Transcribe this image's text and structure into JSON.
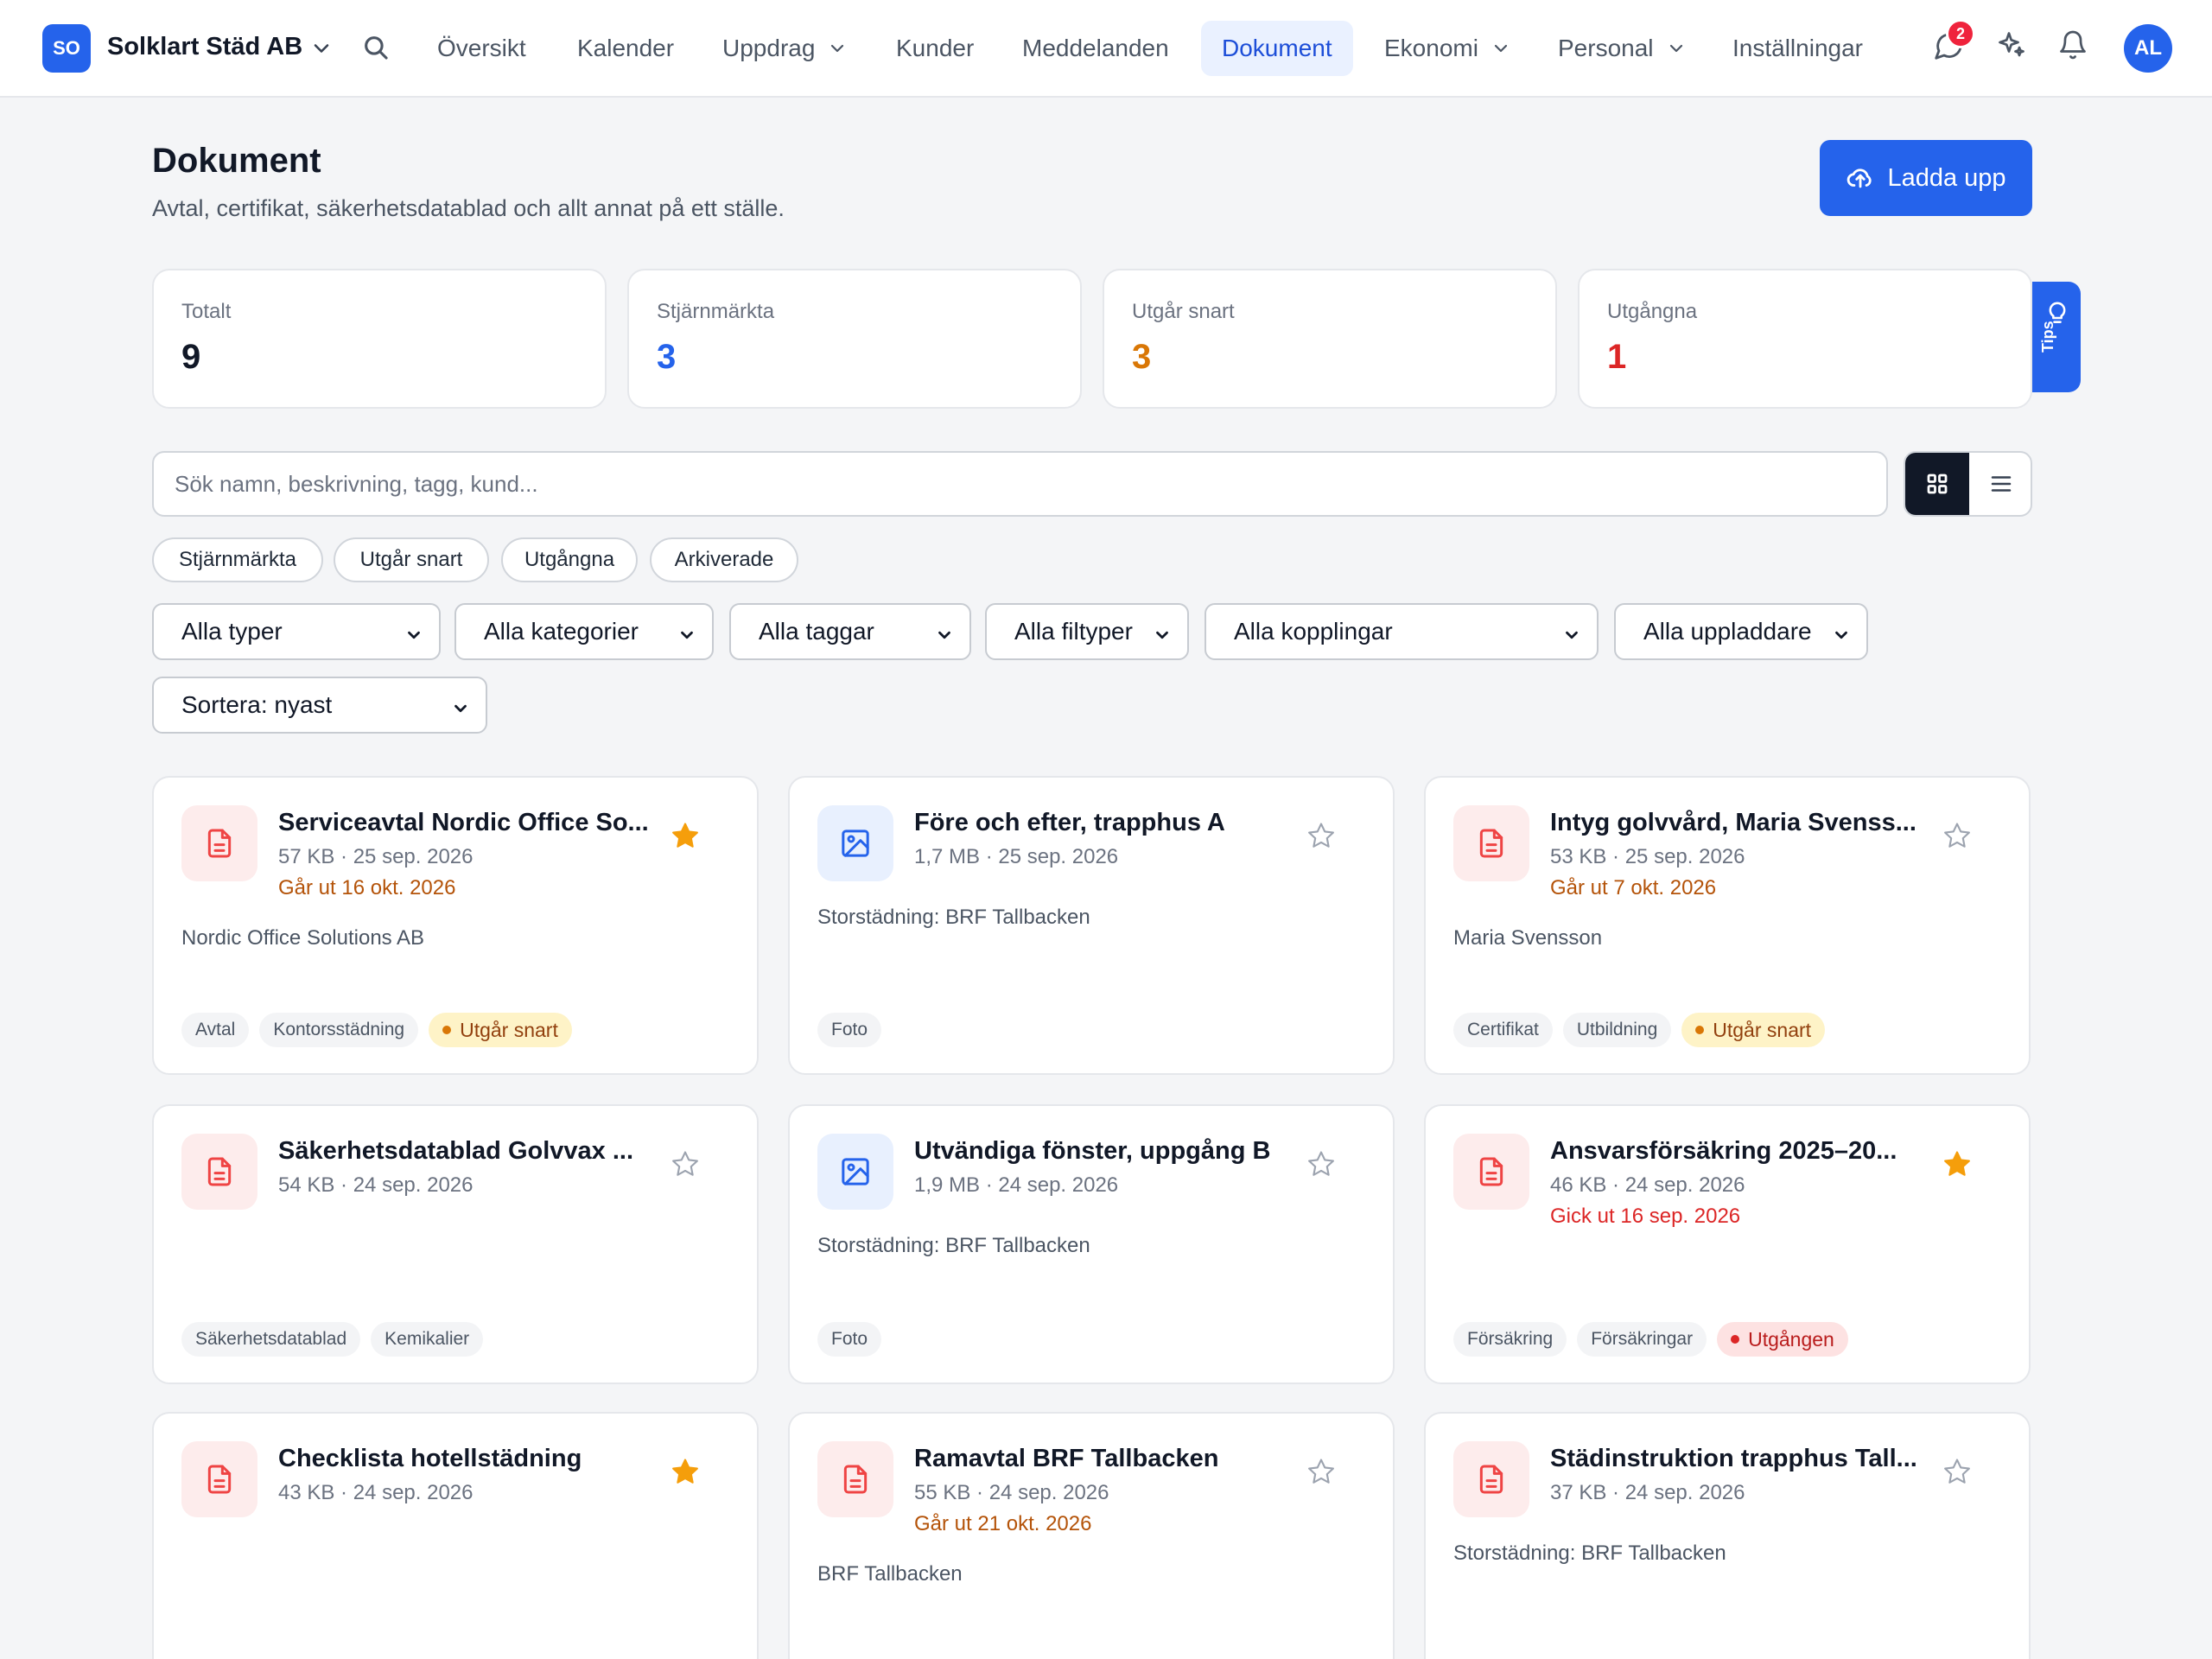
{
  "company": {
    "initials": "SO",
    "name": "Solklart Städ AB"
  },
  "nav": {
    "items": [
      {
        "label": "Översikt"
      },
      {
        "label": "Kalender"
      },
      {
        "label": "Uppdrag"
      },
      {
        "label": "Kunder"
      },
      {
        "label": "Meddelanden"
      },
      {
        "label": "Dokument"
      },
      {
        "label": "Ekonomi"
      },
      {
        "label": "Personal"
      },
      {
        "label": "Inställningar"
      }
    ],
    "active": "Dokument",
    "messages_badge": "2",
    "avatar_initials": "AL"
  },
  "header": {
    "title": "Dokument",
    "subtitle": "Avtal, certifikat, säkerhetsdatablad och allt annat på ett ställe.",
    "upload_label": "Ladda upp"
  },
  "stats": [
    {
      "label": "Totalt",
      "value": "9",
      "color": "#111827"
    },
    {
      "label": "Stjärnmärkta",
      "value": "3",
      "color": "#2563eb"
    },
    {
      "label": "Utgår snart",
      "value": "3",
      "color": "#d97706"
    },
    {
      "label": "Utgångna",
      "value": "1",
      "color": "#dc2626"
    }
  ],
  "tips_label": "Tips",
  "search": {
    "placeholder": "Sök namn, beskrivning, tagg, kund..."
  },
  "quick_filters": [
    "Stjärnmärkta",
    "Utgår snart",
    "Utgångna",
    "Arkiverade"
  ],
  "filters": {
    "type": "Alla typer",
    "category": "Alla kategorier",
    "tags": "Alla taggar",
    "filetype": "Alla filtyper",
    "links": "Alla kopplingar",
    "uploaders": "Alla uppladdare",
    "sort": "Sortera: nyast"
  },
  "documents": [
    {
      "title": "Serviceavtal Nordic Office So...",
      "meta": "57 KB · 25 sep. 2026",
      "expiry": "Går ut 16 okt. 2026",
      "link": "Nordic Office Solutions AB",
      "tags": [
        "Avtal",
        "Kontorsstädning"
      ],
      "status": "Utgår snart"
    },
    {
      "title": "Före och efter, trapphus A",
      "meta": "1,7 MB · 25 sep. 2026",
      "link": "Storstädning: BRF Tallbacken",
      "tags": [
        "Foto"
      ]
    },
    {
      "title": "Intyg golvvård, Maria Svenss...",
      "meta": "53 KB · 25 sep. 2026",
      "expiry": "Går ut 7 okt. 2026",
      "link": "Maria Svensson",
      "tags": [
        "Certifikat",
        "Utbildning"
      ],
      "status": "Utgår snart"
    },
    {
      "title": "Säkerhetsdatablad Golvvax ...",
      "meta": "54 KB · 24 sep. 2026",
      "tags": [
        "Säkerhetsdatablad",
        "Kemikalier"
      ]
    },
    {
      "title": "Utvändiga fönster, uppgång B",
      "meta": "1,9 MB · 24 sep. 2026",
      "link": "Storstädning: BRF Tallbacken",
      "tags": [
        "Foto"
      ]
    },
    {
      "title": "Ansvarsförsäkring 2025–20...",
      "meta": "46 KB · 24 sep. 2026",
      "expiry": "Gick ut 16 sep. 2026",
      "tags": [
        "Försäkring",
        "Försäkringar"
      ],
      "status": "Utgången"
    },
    {
      "title": "Checklista hotellstädning",
      "meta": "43 KB · 24 sep. 2026"
    },
    {
      "title": "Ramavtal BRF Tallbacken",
      "meta": "55 KB · 24 sep. 2026",
      "expiry": "Går ut 21 okt. 2026",
      "link": "BRF Tallbacken"
    },
    {
      "title": "Städinstruktion trapphus Tall...",
      "meta": "37 KB · 24 sep. 2026",
      "link": "Storstädning: BRF Tallbacken"
    }
  ],
  "colors": {
    "accent": "#2563eb",
    "star": "#f59e0b",
    "warning": "#b45309",
    "danger": "#dc2626"
  }
}
